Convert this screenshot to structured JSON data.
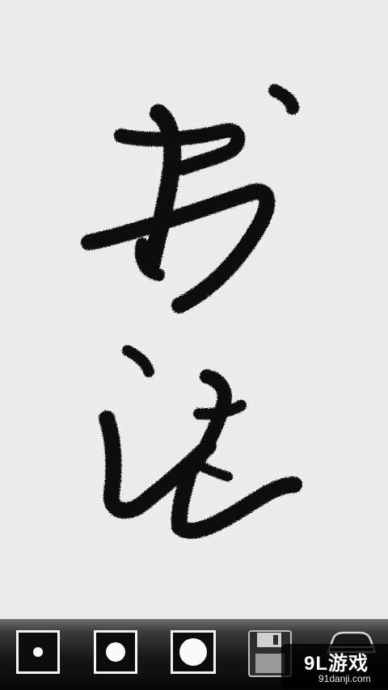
{
  "canvas": {
    "background": "#ececec",
    "ink_color": "#0e0e0e",
    "characters": [
      "书",
      "法"
    ]
  },
  "toolbar": {
    "brushes": [
      {
        "name": "small",
        "icon": "small-dot-icon"
      },
      {
        "name": "medium",
        "icon": "medium-dot-icon"
      },
      {
        "name": "large",
        "icon": "large-dot-icon"
      }
    ],
    "save_icon": "floppy-disk-icon",
    "clear_icon": "eraser-icon"
  },
  "watermark": {
    "logo": "9L游戏",
    "url": "91danji.com"
  }
}
